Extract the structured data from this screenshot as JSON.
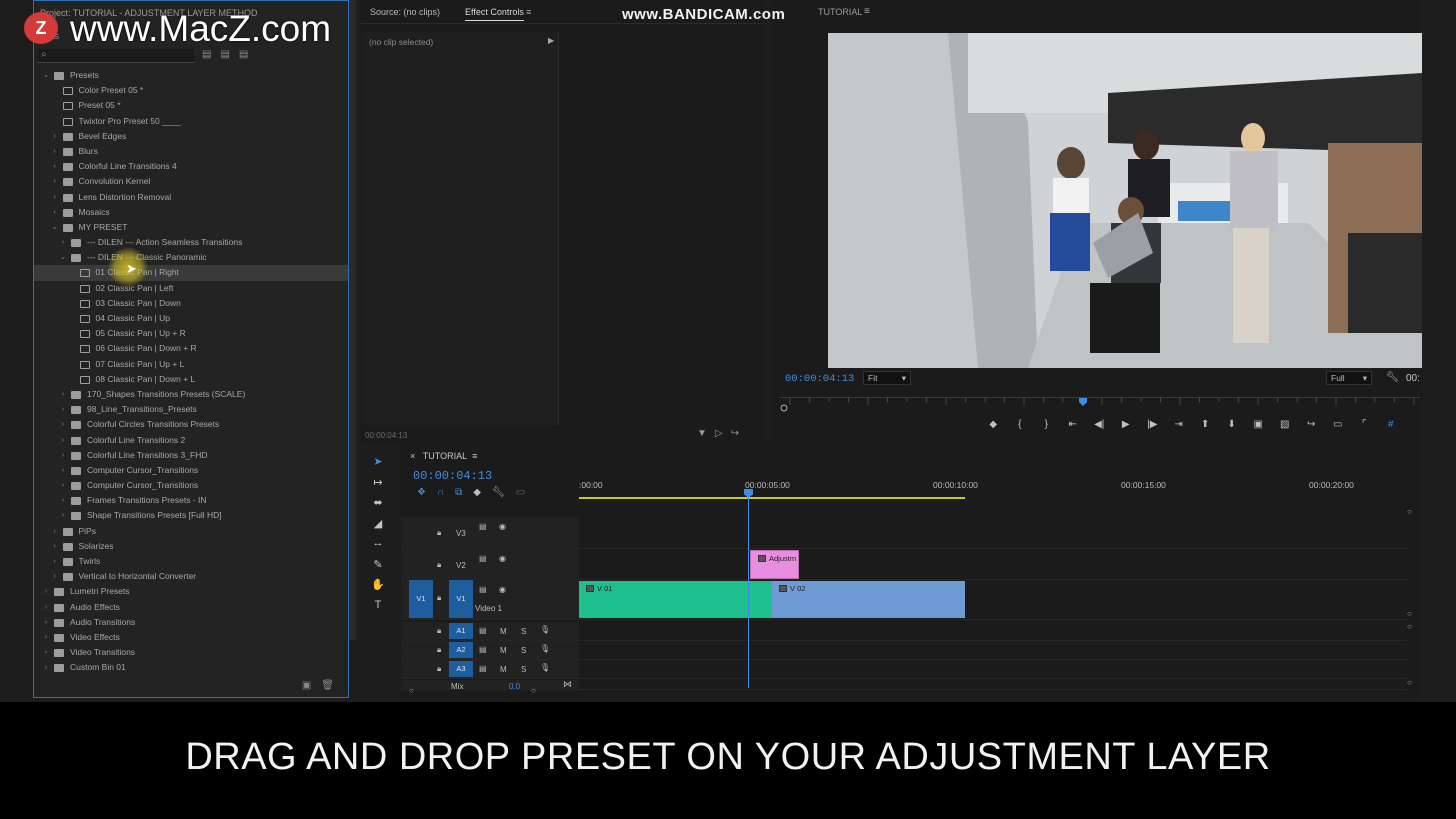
{
  "watermark": {
    "logo_letter": "Z",
    "text": "www.MacZ.com"
  },
  "recorder_watermark": "www.BANDICAM.com",
  "project_panel": {
    "title": "Project: TUTORIAL - ADJUSTMENT LAYER METHOD",
    "tab": "...cts",
    "search_placeholder": "",
    "tree": [
      {
        "indent": 0,
        "type": "folder",
        "open": true,
        "label": "Presets"
      },
      {
        "indent": 1,
        "type": "preset",
        "label": "Color Preset 05 *"
      },
      {
        "indent": 1,
        "type": "preset",
        "label": "Preset 05 *"
      },
      {
        "indent": 1,
        "type": "preset",
        "label": "Twixtor Pro Preset 50 ____"
      },
      {
        "indent": 1,
        "type": "folder",
        "open": false,
        "label": "Bevel Edges"
      },
      {
        "indent": 1,
        "type": "folder",
        "open": false,
        "label": "Blurs"
      },
      {
        "indent": 1,
        "type": "folder",
        "open": false,
        "label": "Colorful Line Transitions 4"
      },
      {
        "indent": 1,
        "type": "folder",
        "open": false,
        "label": "Convolution Kernel"
      },
      {
        "indent": 1,
        "type": "folder",
        "open": false,
        "label": "Lens Distortion Removal"
      },
      {
        "indent": 1,
        "type": "folder",
        "open": false,
        "label": "Mosaics"
      },
      {
        "indent": 1,
        "type": "folder",
        "open": true,
        "label": "MY PRESET"
      },
      {
        "indent": 2,
        "type": "folder",
        "open": false,
        "label": "--- DILEN --- Action Seamless Transitions"
      },
      {
        "indent": 2,
        "type": "folder",
        "open": true,
        "label": "--- DILEN --- Classic Panoramic"
      },
      {
        "indent": 3,
        "type": "preset",
        "label": "01 Classic Pan | Right",
        "selected": true
      },
      {
        "indent": 3,
        "type": "preset",
        "label": "02 Classic Pan | Left"
      },
      {
        "indent": 3,
        "type": "preset",
        "label": "03 Classic Pan | Down"
      },
      {
        "indent": 3,
        "type": "preset",
        "label": "04 Classic Pan | Up"
      },
      {
        "indent": 3,
        "type": "preset",
        "label": "05 Classic Pan | Up + R"
      },
      {
        "indent": 3,
        "type": "preset",
        "label": "06 Classic Pan | Down + R"
      },
      {
        "indent": 3,
        "type": "preset",
        "label": "07 Classic Pan | Up + L"
      },
      {
        "indent": 3,
        "type": "preset",
        "label": "08 Classic Pan | Down + L"
      },
      {
        "indent": 2,
        "type": "folder",
        "open": false,
        "label": "170_Shapes Transitions Presets (SCALE)"
      },
      {
        "indent": 2,
        "type": "folder",
        "open": false,
        "label": "98_Line_Transitions_Presets"
      },
      {
        "indent": 2,
        "type": "folder",
        "open": false,
        "label": "Colorful Circles Transitions Presets"
      },
      {
        "indent": 2,
        "type": "folder",
        "open": false,
        "label": "Colorful Line Transitions 2"
      },
      {
        "indent": 2,
        "type": "folder",
        "open": false,
        "label": "Colorful Line Transitions 3_FHD"
      },
      {
        "indent": 2,
        "type": "folder",
        "open": false,
        "label": "Computer Cursor_Transitions"
      },
      {
        "indent": 2,
        "type": "folder",
        "open": false,
        "label": "Computer Cursor_Transitions"
      },
      {
        "indent": 2,
        "type": "folder",
        "open": false,
        "label": "Frames Transitions Presets - IN"
      },
      {
        "indent": 2,
        "type": "folder",
        "open": false,
        "label": "Shape Transitions Presets [Full HD]"
      },
      {
        "indent": 1,
        "type": "folder",
        "open": false,
        "label": "PiPs"
      },
      {
        "indent": 1,
        "type": "folder",
        "open": false,
        "label": "Solarizes"
      },
      {
        "indent": 1,
        "type": "folder",
        "open": false,
        "label": "Twirls"
      },
      {
        "indent": 1,
        "type": "folder",
        "open": false,
        "label": "Vertical to Horizontal Converter"
      },
      {
        "indent": 0,
        "type": "folder",
        "open": false,
        "label": "Lumetri Presets"
      },
      {
        "indent": 0,
        "type": "folder",
        "open": false,
        "label": "Audio Effects"
      },
      {
        "indent": 0,
        "type": "folder",
        "open": false,
        "label": "Audio Transitions"
      },
      {
        "indent": 0,
        "type": "folder",
        "open": false,
        "label": "Video Effects"
      },
      {
        "indent": 0,
        "type": "folder",
        "open": false,
        "label": "Video Transitions"
      },
      {
        "indent": 0,
        "type": "folder",
        "open": false,
        "label": "Custom Bin 01"
      }
    ]
  },
  "source_panel": {
    "source_tab": "Source: (no clips)",
    "effect_controls_tab": "Effect Controls",
    "no_clip": "(no clip selected)",
    "timecode": "00:00:04:13"
  },
  "program_monitor": {
    "title": "TUTORIAL",
    "timecode": "00:00:04:13",
    "fit": "Fit",
    "resolution": "Full",
    "timecode_right": "00:"
  },
  "timeline": {
    "sequence": "TUTORIAL",
    "timecode": "00:00:04:13",
    "ruler_labels": [
      ":00:00",
      "00:00:05:00",
      "00:00:10:00",
      "00:00:15:00",
      "00:00:20:00"
    ],
    "tracks": {
      "v3": "V3",
      "v2": "V2",
      "v1": "V1",
      "v1_src": "V1",
      "v1_name": "Video 1",
      "a1": "A1",
      "a2": "A2",
      "a3": "A3",
      "mix": "Mix",
      "mix_val": "0.0",
      "m": "M",
      "s": "S"
    },
    "clips": {
      "adjust": "Adjustm",
      "v01": "V 01",
      "v02": "V 02"
    }
  },
  "caption": "DRAG AND DROP PRESET ON YOUR ADJUSTMENT LAYER",
  "colors": {
    "accent_blue": "#3d8ee0",
    "clip_green": "#1dbf8e",
    "clip_blue": "#6e9bd4",
    "clip_pink": "#e98de0"
  }
}
